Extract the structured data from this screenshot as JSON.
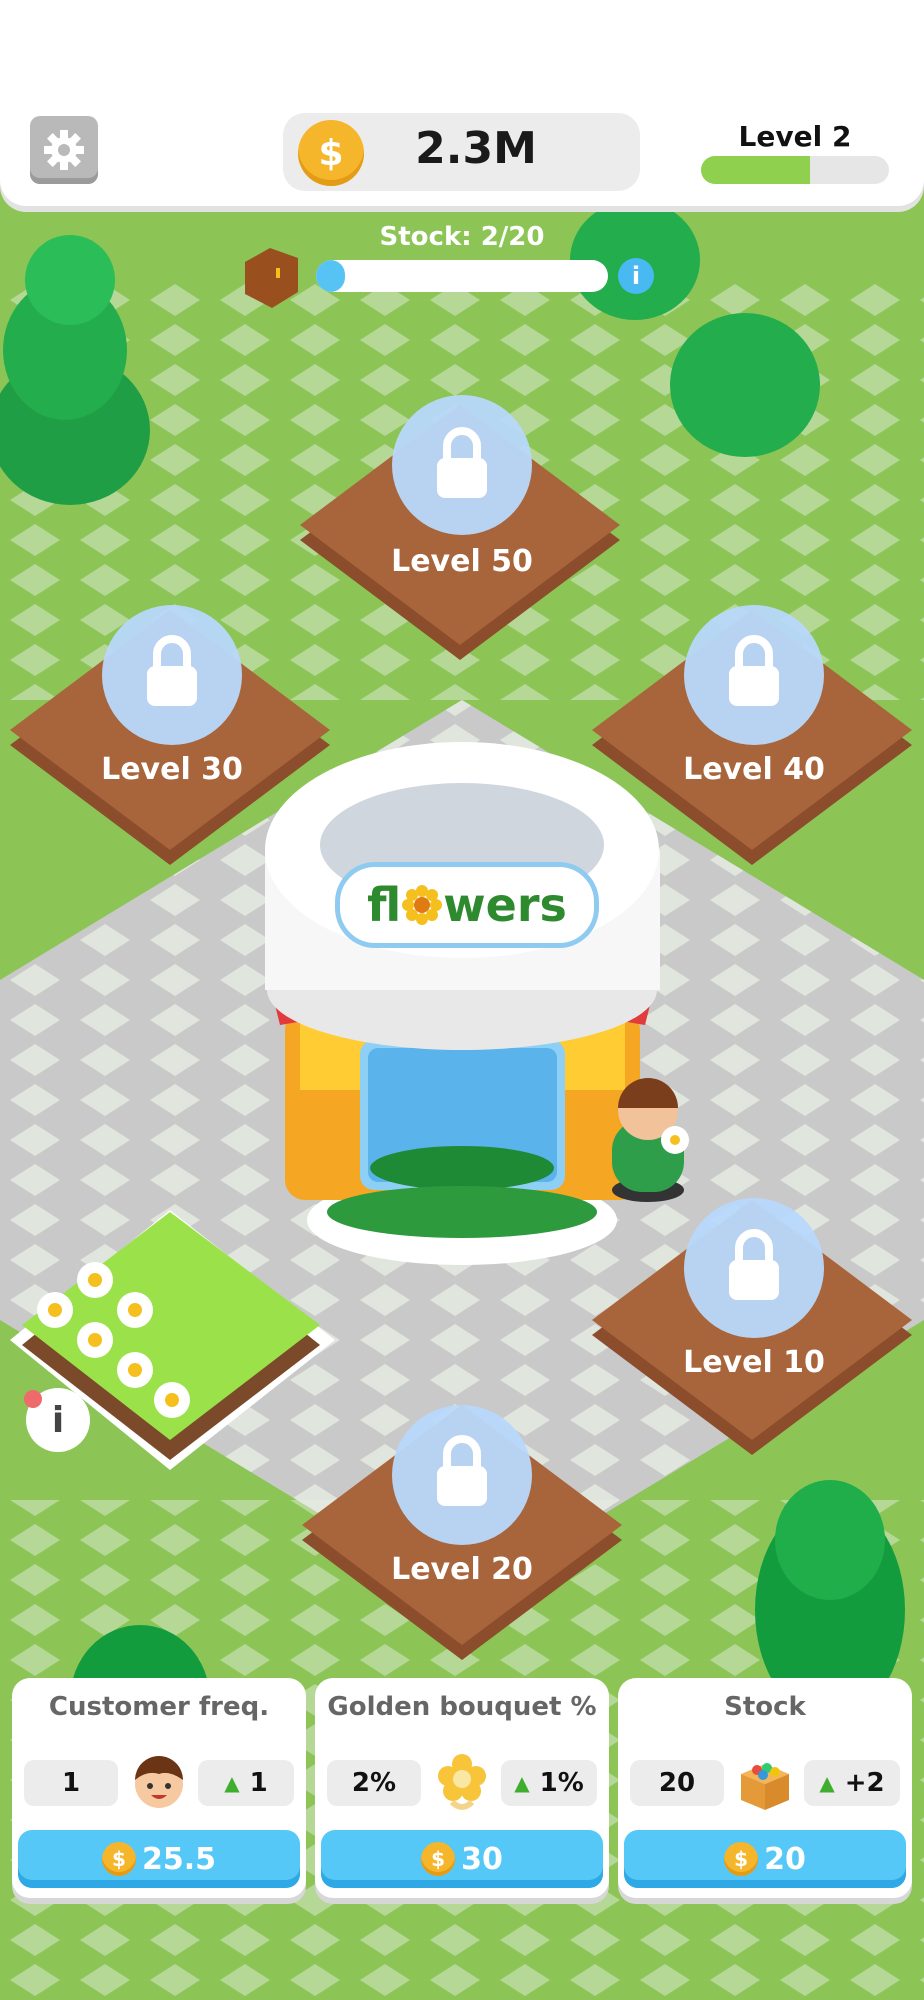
{
  "header": {
    "money": "2.3M",
    "coin_icon": "dollar-coin-icon",
    "settings_icon": "gear-icon",
    "level_label": "Level 2",
    "level_progress": 0.58
  },
  "stock": {
    "label": "Stock: 2/20",
    "progress": 0.1,
    "info": "i"
  },
  "plots": [
    {
      "label": "Level 50"
    },
    {
      "label": "Level 30"
    },
    {
      "label": "Level 40"
    },
    {
      "label": "Level 10"
    },
    {
      "label": "Level 20"
    }
  ],
  "shop": {
    "sign_pre": "fl",
    "sign_post": "wers"
  },
  "garden_info": "i",
  "cards": [
    {
      "title": "Customer freq.",
      "current": "1",
      "increment": "1",
      "price": "25.5",
      "icon": "customer-face-icon"
    },
    {
      "title": "Golden bouquet %",
      "current": "2%",
      "increment": "1%",
      "price": "30",
      "icon": "golden-flower-icon"
    },
    {
      "title": "Stock",
      "current": "20",
      "increment": "+2",
      "price": "20",
      "icon": "box-icon"
    }
  ],
  "colors": {
    "grass": "#8cc556",
    "accent_blue": "#55c8f7",
    "coin": "#f6b62b",
    "soil": "#a8643a"
  }
}
